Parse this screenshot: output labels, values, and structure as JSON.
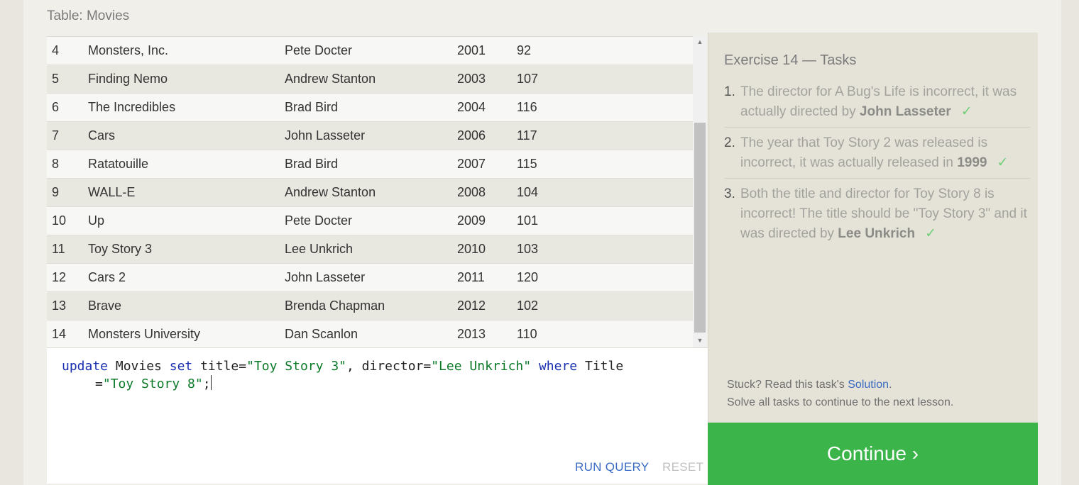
{
  "table": {
    "label": "Table: Movies",
    "rows": [
      {
        "id": "4",
        "title": "Monsters, Inc.",
        "director": "Pete Docter",
        "year": "2001",
        "length": "92"
      },
      {
        "id": "5",
        "title": "Finding Nemo",
        "director": "Andrew Stanton",
        "year": "2003",
        "length": "107"
      },
      {
        "id": "6",
        "title": "The Incredibles",
        "director": "Brad Bird",
        "year": "2004",
        "length": "116"
      },
      {
        "id": "7",
        "title": "Cars",
        "director": "John Lasseter",
        "year": "2006",
        "length": "117"
      },
      {
        "id": "8",
        "title": "Ratatouille",
        "director": "Brad Bird",
        "year": "2007",
        "length": "115"
      },
      {
        "id": "9",
        "title": "WALL-E",
        "director": "Andrew Stanton",
        "year": "2008",
        "length": "104"
      },
      {
        "id": "10",
        "title": "Up",
        "director": "Pete Docter",
        "year": "2009",
        "length": "101"
      },
      {
        "id": "11",
        "title": "Toy Story 3",
        "director": "Lee Unkrich",
        "year": "2010",
        "length": "103"
      },
      {
        "id": "12",
        "title": "Cars 2",
        "director": "John Lasseter",
        "year": "2011",
        "length": "120"
      },
      {
        "id": "13",
        "title": "Brave",
        "director": "Brenda Chapman",
        "year": "2012",
        "length": "102"
      },
      {
        "id": "14",
        "title": "Monsters University",
        "director": "Dan Scanlon",
        "year": "2013",
        "length": "110"
      }
    ]
  },
  "editor": {
    "line1": [
      {
        "t": "update",
        "k": "kw"
      },
      {
        "t": " Movies ",
        "k": ""
      },
      {
        "t": "set",
        "k": "kw"
      },
      {
        "t": " title=",
        "k": ""
      },
      {
        "t": "\"Toy Story 3\"",
        "k": "str"
      },
      {
        "t": ", director=",
        "k": ""
      },
      {
        "t": "\"Lee Unkrich\"",
        "k": "str"
      },
      {
        "t": " ",
        "k": ""
      },
      {
        "t": "where",
        "k": "kw"
      },
      {
        "t": " Title",
        "k": ""
      }
    ],
    "line2": [
      {
        "t": "=",
        "k": ""
      },
      {
        "t": "\"Toy Story 8\"",
        "k": "str"
      },
      {
        "t": ";",
        "k": ""
      }
    ],
    "run_label": "RUN QUERY",
    "reset_label": "RESET"
  },
  "tasks": {
    "title": "Exercise 14 — Tasks",
    "items": [
      {
        "num": "1.",
        "text": "The director for A Bug's Life is incorrect, it was actually directed by ",
        "bold": "John Lasseter",
        "done": true
      },
      {
        "num": "2.",
        "text": "The year that Toy Story 2 was released is incorrect, it was actually released in ",
        "bold": "1999",
        "done": true
      },
      {
        "num": "3.",
        "text": "Both the title and director for Toy Story 8 is incorrect! The title should be \"Toy Story 3\" and it was directed by ",
        "bold": "Lee Unkrich",
        "done": true
      }
    ],
    "check_glyph": "✓",
    "stuck_prefix": "Stuck? Read this task's ",
    "solution_link": "Solution",
    "stuck_suffix": ".",
    "solve_all": "Solve all tasks to continue to the next lesson."
  },
  "continue_label": "Continue ›",
  "colors": {
    "continue_bg": "#3bb54a",
    "link": "#3a6bc4",
    "check": "#6fcf77"
  }
}
